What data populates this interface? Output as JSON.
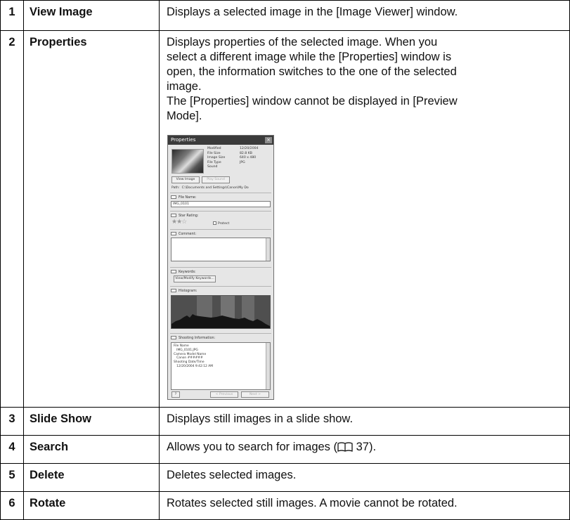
{
  "rows": [
    {
      "num": "1",
      "term": "View Image",
      "desc": "Displays a selected image in the [Image Viewer] window."
    },
    {
      "num": "2",
      "term": "Properties",
      "desc_lines": [
        "Displays properties of the selected image. When you",
        "select a different image while the [Properties] window is",
        "open, the information switches to the one of the selected",
        "image.",
        "The [Properties] window cannot be displayed in [Preview",
        "Mode]."
      ]
    },
    {
      "num": "3",
      "term": "Slide Show",
      "desc": "Displays still images in a slide show."
    },
    {
      "num": "4",
      "term": "Search",
      "desc_before": "Allows you to search for images (",
      "desc_page": "37",
      "desc_after": ")."
    },
    {
      "num": "5",
      "term": "Delete",
      "desc": "Deletes selected images."
    },
    {
      "num": "6",
      "term": "Rotate",
      "desc": "Rotates selected still images. A movie cannot be rotated."
    }
  ],
  "properties_window": {
    "title": "Properties",
    "info": [
      {
        "k": "Modified",
        "v": "12/20/2004"
      },
      {
        "k": "File Size",
        "v": "82.8 KB"
      },
      {
        "k": "Image Size",
        "v": "640 x 480"
      },
      {
        "k": "File Type",
        "v": "JPG"
      },
      {
        "k": "Sound",
        "v": ""
      }
    ],
    "view_image_btn": "View Image",
    "play_sound_btn": "Play Sound",
    "path_label": "Path:",
    "path_value": "C:\\Documents and Settings\\Canon\\My Do",
    "file_name_label": "File Name:",
    "file_name_value": "IMG_0101",
    "star_rating_label": "Star Rating:",
    "stars": "★★☆",
    "protect_label": "Protect",
    "comment_label": "Comment:",
    "keywords_label": "Keywords:",
    "keywords_btn": "View/Modify Keywords...",
    "histogram_label": "Histogram:",
    "shooting_label": "Shooting Information:",
    "shooting_lines": [
      "File Name",
      "   IMG_0101.JPG",
      "Camera Model Name",
      "   Canon ######",
      "Shooting Date/Time",
      "   12/20/2004 9:42:12 AM"
    ],
    "help_btn": "?",
    "prev_btn": "< Previous",
    "next_btn": "Next >"
  }
}
